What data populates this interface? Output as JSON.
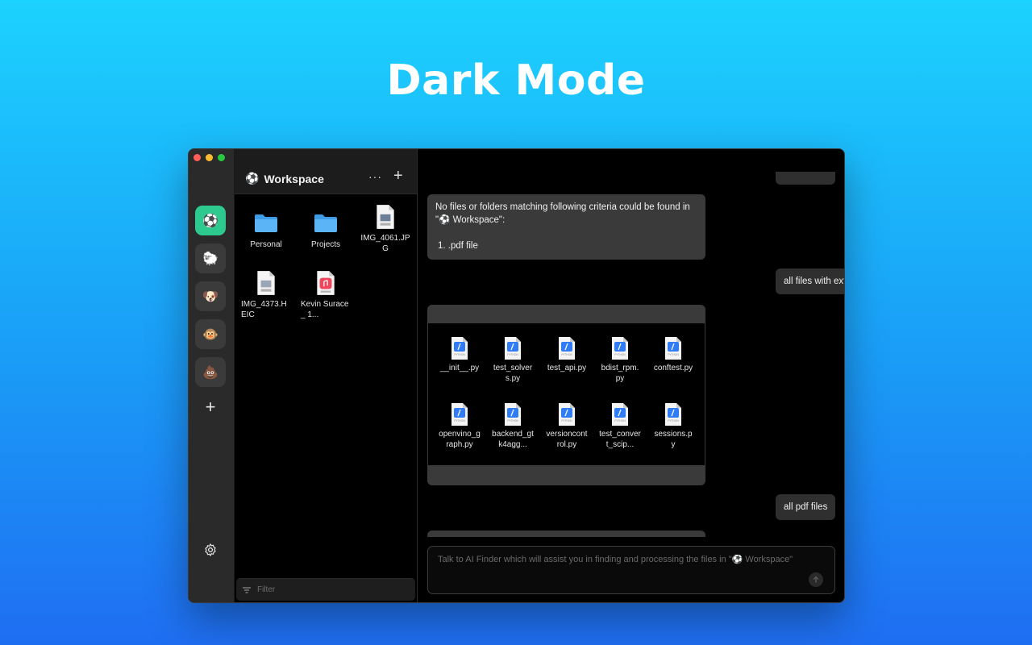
{
  "hero": {
    "title": "Dark Mode"
  },
  "rail": {
    "workspaces": [
      {
        "emoji": "⚽",
        "name": "soccer-ball-icon",
        "active": true
      },
      {
        "emoji": "🐑",
        "name": "sheep-icon",
        "active": false
      },
      {
        "emoji": "🐶",
        "name": "dog-icon",
        "active": false
      },
      {
        "emoji": "🐵",
        "name": "monkey-icon",
        "active": false
      },
      {
        "emoji": "💩",
        "name": "poop-icon",
        "active": false
      }
    ],
    "add_label": "+"
  },
  "pane": {
    "emoji": "⚽",
    "title": "Workspace",
    "more_label": "···",
    "add_label": "+",
    "files": [
      {
        "label": "Personal",
        "kind": "folder"
      },
      {
        "label": "Projects",
        "kind": "folder"
      },
      {
        "label": "IMG_4061.JPG",
        "kind": "image"
      },
      {
        "label": "IMG_4373.HEIC",
        "kind": "heic"
      },
      {
        "label": "Kevin Surace_ 1...",
        "kind": "audio"
      }
    ],
    "filter_placeholder": "Filter"
  },
  "chat": {
    "message_1": {
      "line1": "No files or folders matching following criteria could be found in",
      "line2_quote_open": "\"",
      "workspace_emoji": "⚽",
      "line2_rest": " Workspace\":",
      "item": "1.  .pdf file"
    },
    "user_1": "all files with extension \"py\"",
    "py_files": [
      {
        "label": "__init__.py"
      },
      {
        "label": "test_solvers.py"
      },
      {
        "label": "test_api.py"
      },
      {
        "label": "bdist_rpm.py"
      },
      {
        "label": "conftest.py"
      },
      {
        "label": "openvino_graph.py"
      },
      {
        "label": "backend_gtk4agg..."
      },
      {
        "label": "versioncontrol.py"
      },
      {
        "label": "test_convert_scip..."
      },
      {
        "label": "sessions.py"
      }
    ],
    "py_icon_text": "PYTHON",
    "user_2": "all pdf files",
    "composer_placeholder": "Talk to AI Finder which will assist you in finding and processing the files in \"⚽ Workspace\""
  },
  "colors": {
    "background_top": "#1cd2fe",
    "background_bottom": "#1f6ef2",
    "active_workspace": "#2ec98f",
    "folder_blue": "#5ab4f5",
    "python_blue": "#2f7cf6"
  }
}
